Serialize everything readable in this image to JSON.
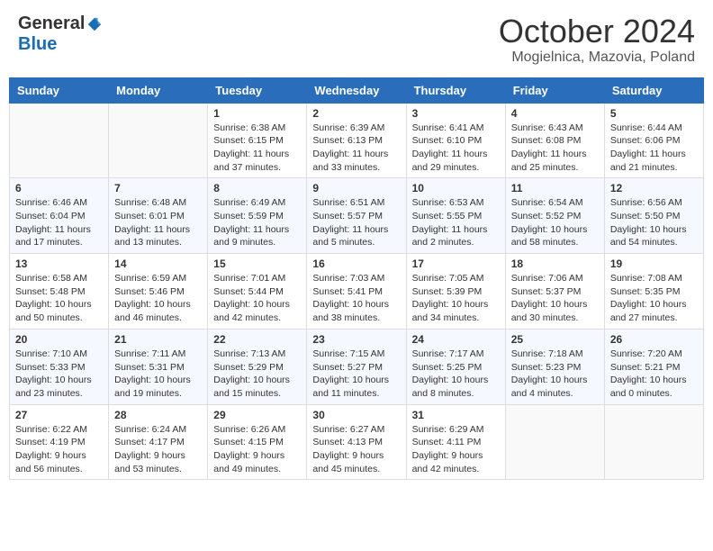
{
  "header": {
    "logo_general": "General",
    "logo_blue": "Blue",
    "month_title": "October 2024",
    "location": "Mogielnica, Mazovia, Poland"
  },
  "days_of_week": [
    "Sunday",
    "Monday",
    "Tuesday",
    "Wednesday",
    "Thursday",
    "Friday",
    "Saturday"
  ],
  "weeks": [
    [
      {
        "day": "",
        "info": ""
      },
      {
        "day": "",
        "info": ""
      },
      {
        "day": "1",
        "sunrise": "6:38 AM",
        "sunset": "6:15 PM",
        "daylight": "11 hours and 37 minutes."
      },
      {
        "day": "2",
        "sunrise": "6:39 AM",
        "sunset": "6:13 PM",
        "daylight": "11 hours and 33 minutes."
      },
      {
        "day": "3",
        "sunrise": "6:41 AM",
        "sunset": "6:10 PM",
        "daylight": "11 hours and 29 minutes."
      },
      {
        "day": "4",
        "sunrise": "6:43 AM",
        "sunset": "6:08 PM",
        "daylight": "11 hours and 25 minutes."
      },
      {
        "day": "5",
        "sunrise": "6:44 AM",
        "sunset": "6:06 PM",
        "daylight": "11 hours and 21 minutes."
      }
    ],
    [
      {
        "day": "6",
        "sunrise": "6:46 AM",
        "sunset": "6:04 PM",
        "daylight": "11 hours and 17 minutes."
      },
      {
        "day": "7",
        "sunrise": "6:48 AM",
        "sunset": "6:01 PM",
        "daylight": "11 hours and 13 minutes."
      },
      {
        "day": "8",
        "sunrise": "6:49 AM",
        "sunset": "5:59 PM",
        "daylight": "11 hours and 9 minutes."
      },
      {
        "day": "9",
        "sunrise": "6:51 AM",
        "sunset": "5:57 PM",
        "daylight": "11 hours and 5 minutes."
      },
      {
        "day": "10",
        "sunrise": "6:53 AM",
        "sunset": "5:55 PM",
        "daylight": "11 hours and 2 minutes."
      },
      {
        "day": "11",
        "sunrise": "6:54 AM",
        "sunset": "5:52 PM",
        "daylight": "10 hours and 58 minutes."
      },
      {
        "day": "12",
        "sunrise": "6:56 AM",
        "sunset": "5:50 PM",
        "daylight": "10 hours and 54 minutes."
      }
    ],
    [
      {
        "day": "13",
        "sunrise": "6:58 AM",
        "sunset": "5:48 PM",
        "daylight": "10 hours and 50 minutes."
      },
      {
        "day": "14",
        "sunrise": "6:59 AM",
        "sunset": "5:46 PM",
        "daylight": "10 hours and 46 minutes."
      },
      {
        "day": "15",
        "sunrise": "7:01 AM",
        "sunset": "5:44 PM",
        "daylight": "10 hours and 42 minutes."
      },
      {
        "day": "16",
        "sunrise": "7:03 AM",
        "sunset": "5:41 PM",
        "daylight": "10 hours and 38 minutes."
      },
      {
        "day": "17",
        "sunrise": "7:05 AM",
        "sunset": "5:39 PM",
        "daylight": "10 hours and 34 minutes."
      },
      {
        "day": "18",
        "sunrise": "7:06 AM",
        "sunset": "5:37 PM",
        "daylight": "10 hours and 30 minutes."
      },
      {
        "day": "19",
        "sunrise": "7:08 AM",
        "sunset": "5:35 PM",
        "daylight": "10 hours and 27 minutes."
      }
    ],
    [
      {
        "day": "20",
        "sunrise": "7:10 AM",
        "sunset": "5:33 PM",
        "daylight": "10 hours and 23 minutes."
      },
      {
        "day": "21",
        "sunrise": "7:11 AM",
        "sunset": "5:31 PM",
        "daylight": "10 hours and 19 minutes."
      },
      {
        "day": "22",
        "sunrise": "7:13 AM",
        "sunset": "5:29 PM",
        "daylight": "10 hours and 15 minutes."
      },
      {
        "day": "23",
        "sunrise": "7:15 AM",
        "sunset": "5:27 PM",
        "daylight": "10 hours and 11 minutes."
      },
      {
        "day": "24",
        "sunrise": "7:17 AM",
        "sunset": "5:25 PM",
        "daylight": "10 hours and 8 minutes."
      },
      {
        "day": "25",
        "sunrise": "7:18 AM",
        "sunset": "5:23 PM",
        "daylight": "10 hours and 4 minutes."
      },
      {
        "day": "26",
        "sunrise": "7:20 AM",
        "sunset": "5:21 PM",
        "daylight": "10 hours and 0 minutes."
      }
    ],
    [
      {
        "day": "27",
        "sunrise": "6:22 AM",
        "sunset": "4:19 PM",
        "daylight": "9 hours and 56 minutes."
      },
      {
        "day": "28",
        "sunrise": "6:24 AM",
        "sunset": "4:17 PM",
        "daylight": "9 hours and 53 minutes."
      },
      {
        "day": "29",
        "sunrise": "6:26 AM",
        "sunset": "4:15 PM",
        "daylight": "9 hours and 49 minutes."
      },
      {
        "day": "30",
        "sunrise": "6:27 AM",
        "sunset": "4:13 PM",
        "daylight": "9 hours and 45 minutes."
      },
      {
        "day": "31",
        "sunrise": "6:29 AM",
        "sunset": "4:11 PM",
        "daylight": "9 hours and 42 minutes."
      },
      {
        "day": "",
        "info": ""
      },
      {
        "day": "",
        "info": ""
      }
    ]
  ]
}
